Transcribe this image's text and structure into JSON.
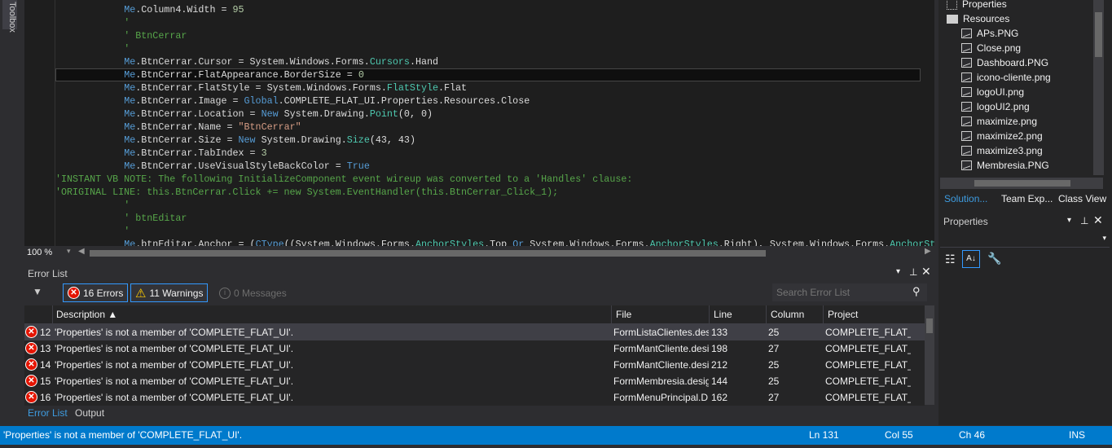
{
  "toolbox": {
    "label": "Toolbox"
  },
  "editor": {
    "zoom": "100 %",
    "lines": [
      {
        "indent": 12,
        "tokens": [
          [
            "kw",
            "Me"
          ],
          [
            "",
            "."
          ],
          [
            "",
            "Column4.Width = "
          ],
          [
            "nu",
            "95"
          ]
        ]
      },
      {
        "indent": 12,
        "tokens": [
          [
            "cm",
            "'"
          ]
        ]
      },
      {
        "indent": 12,
        "tokens": [
          [
            "cm",
            "' BtnCerrar"
          ]
        ]
      },
      {
        "indent": 12,
        "tokens": [
          [
            "cm",
            "'"
          ]
        ]
      },
      {
        "indent": 12,
        "tokens": [
          [
            "kw",
            "Me"
          ],
          [
            "",
            ".BtnCerrar.Cursor = System.Windows.Forms."
          ],
          [
            "ty",
            "Cursors"
          ],
          [
            "",
            ".Hand"
          ]
        ]
      },
      {
        "indent": 12,
        "current": true,
        "tokens": [
          [
            "kw",
            "Me"
          ],
          [
            "",
            ".BtnCerrar.FlatAppearance.BorderSize = "
          ],
          [
            "nu",
            "0"
          ]
        ]
      },
      {
        "indent": 12,
        "tokens": [
          [
            "kw",
            "Me"
          ],
          [
            "",
            ".BtnCerrar.FlatStyle = System.Windows.Forms."
          ],
          [
            "ty",
            "FlatStyle"
          ],
          [
            "",
            ".Flat"
          ]
        ]
      },
      {
        "indent": 12,
        "tokens": [
          [
            "kw",
            "Me"
          ],
          [
            "",
            ".BtnCerrar.Image = "
          ],
          [
            "kw",
            "Global"
          ],
          [
            "",
            ".COMPLETE_FLAT_UI.Properties.Resources.Close"
          ]
        ]
      },
      {
        "indent": 12,
        "tokens": [
          [
            "kw",
            "Me"
          ],
          [
            "",
            ".BtnCerrar.Location = "
          ],
          [
            "kw",
            "New"
          ],
          [
            "",
            " System.Drawing."
          ],
          [
            "ty",
            "Point"
          ],
          [
            "",
            "(0, 0)"
          ]
        ]
      },
      {
        "indent": 12,
        "tokens": [
          [
            "kw",
            "Me"
          ],
          [
            "",
            ".BtnCerrar.Name = "
          ],
          [
            "st",
            "\"BtnCerrar\""
          ]
        ]
      },
      {
        "indent": 12,
        "tokens": [
          [
            "kw",
            "Me"
          ],
          [
            "",
            ".BtnCerrar.Size = "
          ],
          [
            "kw",
            "New"
          ],
          [
            "",
            " System.Drawing."
          ],
          [
            "ty",
            "Size"
          ],
          [
            "",
            "(43, 43)"
          ]
        ]
      },
      {
        "indent": 12,
        "tokens": [
          [
            "kw",
            "Me"
          ],
          [
            "",
            ".BtnCerrar.TabIndex = "
          ],
          [
            "nu",
            "3"
          ]
        ]
      },
      {
        "indent": 12,
        "tokens": [
          [
            "kw",
            "Me"
          ],
          [
            "",
            ".BtnCerrar.UseVisualStyleBackColor = "
          ],
          [
            "kw",
            "True"
          ]
        ]
      },
      {
        "indent": 0,
        "tokens": [
          [
            "cm",
            "'INSTANT VB NOTE: The following InitializeComponent event wireup was converted to a 'Handles' clause:"
          ]
        ]
      },
      {
        "indent": 0,
        "tokens": [
          [
            "cm",
            "'ORIGINAL LINE: this.BtnCerrar.Click += new System.EventHandler(this.BtnCerrar_Click_1);"
          ]
        ]
      },
      {
        "indent": 12,
        "tokens": [
          [
            "cm",
            "'"
          ]
        ]
      },
      {
        "indent": 12,
        "tokens": [
          [
            "cm",
            "' btnEditar"
          ]
        ]
      },
      {
        "indent": 12,
        "tokens": [
          [
            "cm",
            "'"
          ]
        ]
      },
      {
        "indent": 12,
        "tokens": [
          [
            "kw",
            "Me"
          ],
          [
            "",
            ".btnEditar.Anchor = ("
          ],
          [
            "kw",
            "CType"
          ],
          [
            "",
            "((System.Windows.Forms."
          ],
          [
            "ty",
            "AnchorStyles"
          ],
          [
            "",
            ".Top "
          ],
          [
            "kw",
            "Or"
          ],
          [
            "",
            " System.Windows.Forms."
          ],
          [
            "ty",
            "AnchorStyles"
          ],
          [
            "",
            ".Right), System.Windows.Forms."
          ],
          [
            "ty",
            "AnchorStyles"
          ]
        ]
      }
    ]
  },
  "error_list": {
    "title": "Error List",
    "errors_label": "16 Errors",
    "warnings_label": "11 Warnings",
    "messages_label": "0 Messages",
    "search_placeholder": "Search Error List",
    "columns": [
      "Description",
      "File",
      "Line",
      "Column",
      "Project"
    ],
    "rows": [
      {
        "num": "12",
        "description": "'Properties' is not a member of 'COMPLETE_FLAT_UI'.",
        "file": "FormListaClientes.des",
        "line": "133",
        "column": "25",
        "project": "COMPLETE_FLAT_UI"
      },
      {
        "num": "13",
        "description": "'Properties' is not a member of 'COMPLETE_FLAT_UI'.",
        "file": "FormMantCliente.desi",
        "line": "198",
        "column": "27",
        "project": "COMPLETE_FLAT_UI"
      },
      {
        "num": "14",
        "description": "'Properties' is not a member of 'COMPLETE_FLAT_UI'.",
        "file": "FormMantCliente.desi",
        "line": "212",
        "column": "25",
        "project": "COMPLETE_FLAT_UI"
      },
      {
        "num": "15",
        "description": "'Properties' is not a member of 'COMPLETE_FLAT_UI'.",
        "file": "FormMembresia.desig",
        "line": "144",
        "column": "25",
        "project": "COMPLETE_FLAT_UI"
      },
      {
        "num": "16",
        "description": "'Properties' is not a member of 'COMPLETE_FLAT_UI'.",
        "file": "FormMenuPrincipal.D",
        "line": "162",
        "column": "27",
        "project": "COMPLETE_FLAT_UI"
      }
    ],
    "tabs": [
      "Error List",
      "Output"
    ]
  },
  "solution": {
    "items": [
      {
        "label": "Properties",
        "icon": "properties-icon",
        "level": 0
      },
      {
        "label": "Resources",
        "icon": "folder-icon",
        "level": 0
      },
      {
        "label": "APs.PNG",
        "icon": "image-icon",
        "level": 1
      },
      {
        "label": "Close.png",
        "icon": "image-icon",
        "level": 1
      },
      {
        "label": "Dashboard.PNG",
        "icon": "image-icon",
        "level": 1
      },
      {
        "label": "icono-cliente.png",
        "icon": "image-icon",
        "level": 1
      },
      {
        "label": "logoUI.png",
        "icon": "image-icon",
        "level": 1
      },
      {
        "label": "logoUI2.png",
        "icon": "image-icon",
        "level": 1
      },
      {
        "label": "maximize.png",
        "icon": "image-icon",
        "level": 1
      },
      {
        "label": "maximize2.png",
        "icon": "image-icon",
        "level": 1
      },
      {
        "label": "maximize3.png",
        "icon": "image-icon",
        "level": 1
      },
      {
        "label": "Membresia.PNG",
        "icon": "image-icon",
        "level": 1
      }
    ],
    "tabs": [
      "Solution...",
      "Team Exp...",
      "Class View"
    ]
  },
  "properties": {
    "title": "Properties"
  },
  "status": {
    "message": "'Properties' is not a member of 'COMPLETE_FLAT_UI'.",
    "ln": "Ln 131",
    "col": "Col 55",
    "ch": "Ch 46",
    "mode": "INS"
  },
  "colors": {
    "accent": "#007acc",
    "error": "#e51400",
    "warning": "#ffcc00",
    "keyword": "#569cd6",
    "type": "#4ec9b0",
    "string": "#d69d85",
    "comment": "#57a64a"
  }
}
